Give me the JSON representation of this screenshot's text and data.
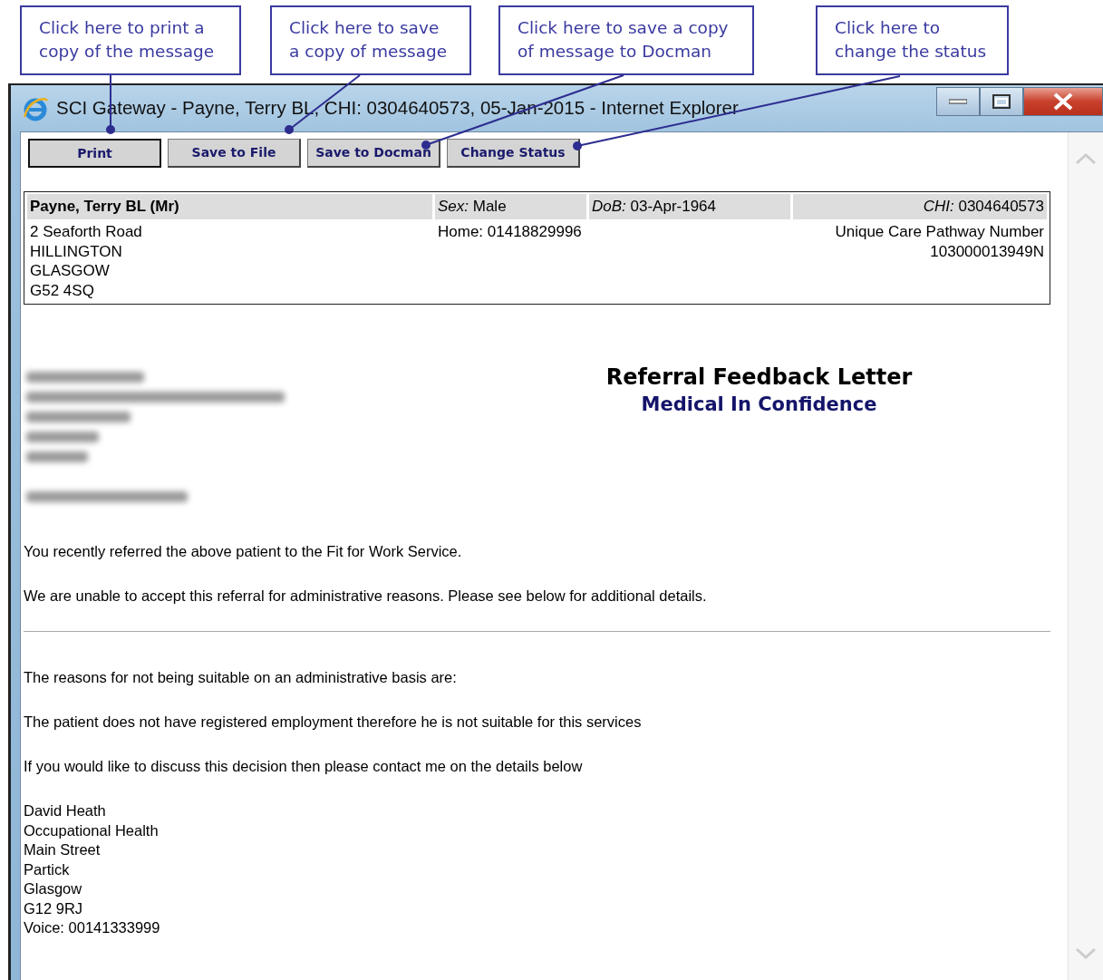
{
  "callouts": [
    {
      "lines": [
        "Click here to print a",
        "copy of the message"
      ]
    },
    {
      "lines": [
        "Click here to save",
        "a copy of message"
      ]
    },
    {
      "lines": [
        "Click here to save a copy",
        "of message to Docman"
      ]
    },
    {
      "lines": [
        "Click here to",
        "change the status"
      ]
    }
  ],
  "window": {
    "title": "SCI Gateway - Payne, Terry BL, CHI: 0304640573, 05-Jan-2015 - Internet Explorer"
  },
  "toolbar": [
    {
      "label": "Print",
      "focused": true
    },
    {
      "label": "Save to File",
      "focused": false
    },
    {
      "label": "Save to Docman",
      "focused": false
    },
    {
      "label": "Change Status",
      "focused": false
    }
  ],
  "patient": {
    "name": "Payne, Terry BL (Mr)",
    "sex": "*Sex:* Male",
    "dob": "*DoB:* 03-Apr-1964",
    "chi": "*CHI:* 0304640573",
    "address": [
      "2 Seaforth Road",
      "HILLINGTON",
      "GLASGOW",
      "G52 4SQ"
    ],
    "home_phone": "Home: 01418829996",
    "ucpn": [
      "Unique Care Pathway Number",
      "103000013949N"
    ]
  },
  "letter": {
    "title": "Referral Feedback Letter",
    "subtitle": "Medical In Confidence",
    "intro": [
      "You recently referred the above patient to the Fit for Work Service.",
      "We are unable to accept this referral for administrative reasons. Please see below for additional details."
    ],
    "details": [
      "The reasons for not being suitable on an administrative basis are:",
      "The patient does not have registered employment therefore he is not suitable for this services",
      "If you would like to discuss this decision then please contact me on the details below"
    ],
    "signature": [
      "David Heath",
      "Occupational Health",
      "Main Street",
      "Partick",
      "Glasgow",
      "G12 9RJ",
      "Voice: 00141333999"
    ]
  }
}
